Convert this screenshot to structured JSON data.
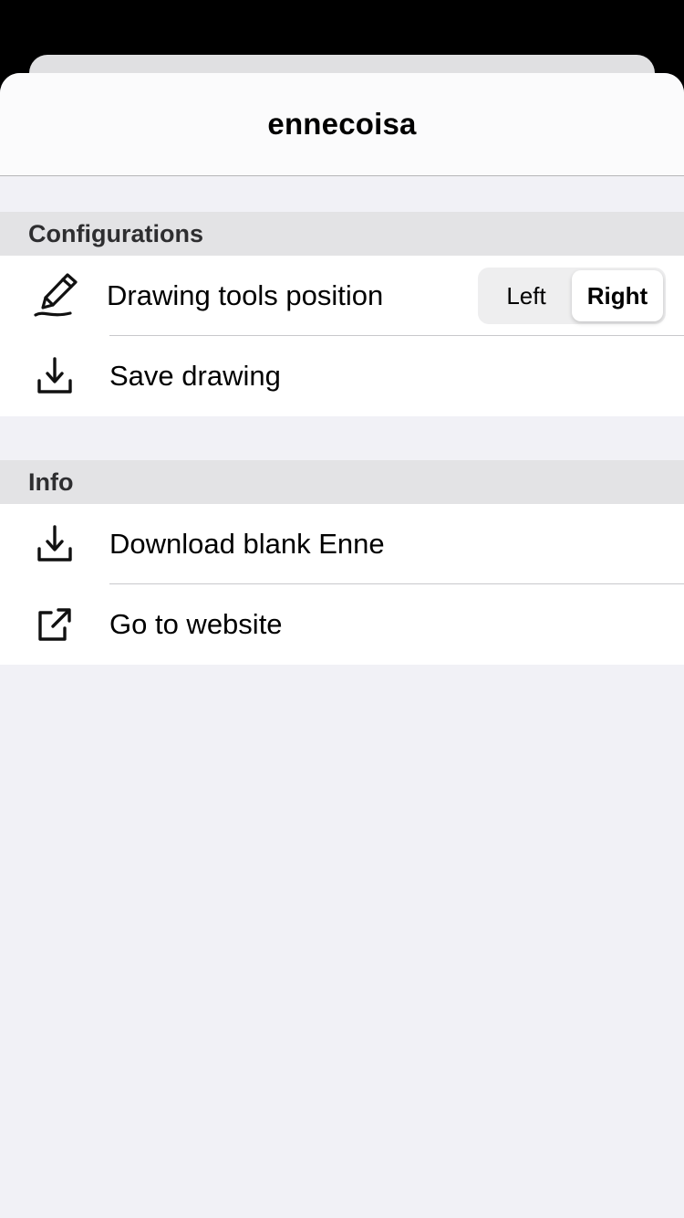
{
  "navbar": {
    "title": "ennecoisa"
  },
  "sections": {
    "configurations": {
      "header": "Configurations",
      "drawing_tools_position": {
        "label": "Drawing tools position",
        "icon": "pencil-icon",
        "options": [
          "Left",
          "Right"
        ],
        "selected": "Right"
      },
      "save_drawing": {
        "label": "Save drawing",
        "icon": "download-icon"
      }
    },
    "info": {
      "header": "Info",
      "download_blank": {
        "label": "Download blank Enne",
        "icon": "download-icon"
      },
      "website": {
        "label": "Go to website",
        "icon": "external-link-icon"
      }
    }
  }
}
